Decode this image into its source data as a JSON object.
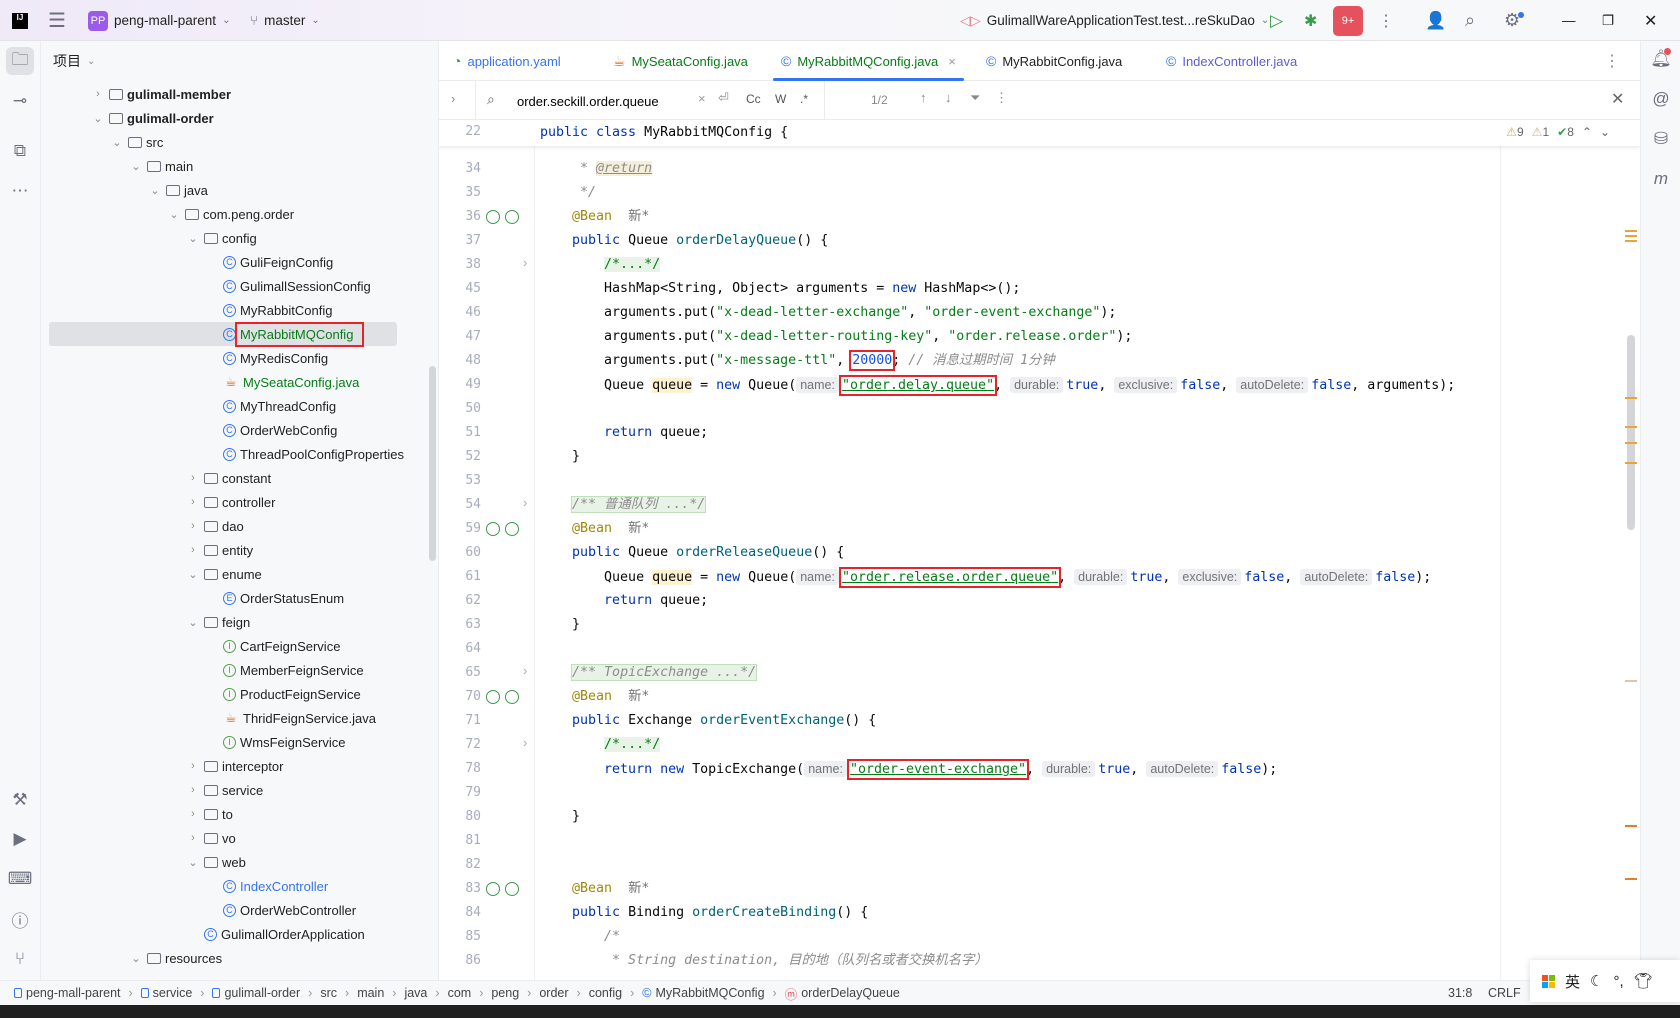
{
  "titlebar": {
    "app_logo": "IJ",
    "project_badge": "PP",
    "project_name": "peng-mall-parent",
    "branch": "master",
    "run_config": "GulimallWareApplicationTest.test...reSkuDao",
    "notif_badge": "9+",
    "icons": [
      "main-menu-icon",
      "branch-icon",
      "run-icon",
      "debug-icon",
      "more-icon",
      "add-user-icon",
      "search-icon",
      "settings-icon",
      "minimize-icon",
      "restore-icon",
      "close-icon"
    ]
  },
  "project_panel": {
    "title": "项目",
    "selected": "MyRabbitMQConfig",
    "items": [
      {
        "label": "gulimall-member",
        "level": 0,
        "arrow": "closed",
        "icon": "module",
        "bold": true
      },
      {
        "label": "gulimall-order",
        "level": 0,
        "arrow": "open",
        "icon": "module",
        "bold": true
      },
      {
        "label": "src",
        "level": 1,
        "arrow": "open",
        "icon": "folder"
      },
      {
        "label": "main",
        "level": 2,
        "arrow": "open",
        "icon": "folder"
      },
      {
        "label": "java",
        "level": 3,
        "arrow": "open",
        "icon": "src-folder"
      },
      {
        "label": "com.peng.order",
        "level": 4,
        "arrow": "open",
        "icon": "package"
      },
      {
        "label": "config",
        "level": 5,
        "arrow": "open",
        "icon": "package"
      },
      {
        "label": "GuliFeignConfig",
        "level": 6,
        "icon": "class"
      },
      {
        "label": "GulimallSessionConfig",
        "level": 6,
        "icon": "class"
      },
      {
        "label": "MyRabbitConfig",
        "level": 6,
        "icon": "class"
      },
      {
        "label": "MyRabbitMQConfig",
        "level": 6,
        "icon": "class",
        "color": "#067d17",
        "selected": true
      },
      {
        "label": "MyRedisConfig",
        "level": 6,
        "icon": "class"
      },
      {
        "label": "MySeataConfig.java",
        "level": 6,
        "icon": "java",
        "color": "#067d17"
      },
      {
        "label": "MyThreadConfig",
        "level": 6,
        "icon": "class"
      },
      {
        "label": "OrderWebConfig",
        "level": 6,
        "icon": "class"
      },
      {
        "label": "ThreadPoolConfigProperties",
        "level": 6,
        "icon": "class"
      },
      {
        "label": "constant",
        "level": 5,
        "arrow": "closed",
        "icon": "package"
      },
      {
        "label": "controller",
        "level": 5,
        "arrow": "closed",
        "icon": "package"
      },
      {
        "label": "dao",
        "level": 5,
        "arrow": "closed",
        "icon": "package"
      },
      {
        "label": "entity",
        "level": 5,
        "arrow": "closed",
        "icon": "package"
      },
      {
        "label": "enume",
        "level": 5,
        "arrow": "open",
        "icon": "package"
      },
      {
        "label": "OrderStatusEnum",
        "level": 6,
        "icon": "enum"
      },
      {
        "label": "feign",
        "level": 5,
        "arrow": "open",
        "icon": "package"
      },
      {
        "label": "CartFeignService",
        "level": 6,
        "icon": "interface"
      },
      {
        "label": "MemberFeignService",
        "level": 6,
        "icon": "interface"
      },
      {
        "label": "ProductFeignService",
        "level": 6,
        "icon": "interface"
      },
      {
        "label": "ThridFeignService.java",
        "level": 6,
        "icon": "java"
      },
      {
        "label": "WmsFeignService",
        "level": 6,
        "icon": "interface"
      },
      {
        "label": "interceptor",
        "level": 5,
        "arrow": "closed",
        "icon": "package"
      },
      {
        "label": "service",
        "level": 5,
        "arrow": "closed",
        "icon": "package"
      },
      {
        "label": "to",
        "level": 5,
        "arrow": "closed",
        "icon": "package"
      },
      {
        "label": "vo",
        "level": 5,
        "arrow": "closed",
        "icon": "package"
      },
      {
        "label": "web",
        "level": 5,
        "arrow": "open",
        "icon": "package"
      },
      {
        "label": "IndexController",
        "level": 6,
        "icon": "class",
        "color": "#3574f0"
      },
      {
        "label": "OrderWebController",
        "level": 6,
        "icon": "class"
      },
      {
        "label": "GulimallOrderApplication",
        "level": 5,
        "icon": "spring-app"
      },
      {
        "label": "resources",
        "level": 2,
        "arrow": "open",
        "icon": "resources-folder"
      }
    ]
  },
  "tabs": [
    {
      "label": "application.yaml",
      "icon": "yaml-icon",
      "color": "#3574f0"
    },
    {
      "label": "MySeataConfig.java",
      "icon": "java-icon",
      "color": "#067d17"
    },
    {
      "label": "MyRabbitMQConfig.java",
      "icon": "class-icon",
      "color": "#067d17",
      "active": true,
      "closable": true
    },
    {
      "label": "MyRabbitConfig.java",
      "icon": "class-icon",
      "color": "#222222"
    },
    {
      "label": "IndexController.java",
      "icon": "class-icon",
      "color": "#5c5cd6"
    }
  ],
  "find": {
    "query": "order.seckill.order.queue",
    "options": [
      "Cc",
      "W",
      ".*"
    ],
    "match_count": "1/2"
  },
  "inspections": {
    "warnings": "9",
    "weak_warnings": "1",
    "ok": "8"
  },
  "sticky": {
    "num": "22",
    "tokens": [
      [
        "public class ",
        "kw"
      ],
      [
        "MyRabbitMQConfig {",
        "plain"
      ]
    ]
  },
  "code": [
    {
      "num": "34",
      "tokens": [
        [
          "     * ",
          "cm"
        ],
        [
          "@return",
          "doctag"
        ]
      ]
    },
    {
      "num": "35",
      "tokens": [
        [
          "     */",
          "cm"
        ]
      ]
    },
    {
      "num": "36",
      "gutter": true,
      "tokens": [
        [
          "    ",
          "plain"
        ],
        [
          "@Bean",
          "ann"
        ],
        [
          "  新*",
          "ai"
        ]
      ]
    },
    {
      "num": "37",
      "tokens": [
        [
          "    public ",
          "kw"
        ],
        [
          "Queue ",
          "plain"
        ],
        [
          "orderDelayQueue",
          "fn"
        ],
        [
          "() {",
          "plain"
        ]
      ]
    },
    {
      "num": "38",
      "fold": true,
      "tokens": [
        [
          "        ",
          "plain"
        ],
        [
          "/*...*/",
          "fold"
        ]
      ]
    },
    {
      "num": "45",
      "tokens": [
        [
          "        HashMap<String, Object> arguments = ",
          "plain"
        ],
        [
          "new ",
          "kw"
        ],
        [
          "HashMap<>();",
          "plain"
        ]
      ]
    },
    {
      "num": "46",
      "tokens": [
        [
          "        arguments.put(",
          "plain"
        ],
        [
          "\"x-dead-letter-exchange\"",
          "str"
        ],
        [
          ", ",
          "plain"
        ],
        [
          "\"order-event-exchange\"",
          "str"
        ],
        [
          ");",
          "plain"
        ]
      ]
    },
    {
      "num": "47",
      "tokens": [
        [
          "        arguments.put(",
          "plain"
        ],
        [
          "\"x-dead-letter-routing-key\"",
          "str"
        ],
        [
          ", ",
          "plain"
        ],
        [
          "\"order.release.order\"",
          "str"
        ],
        [
          ");",
          "plain"
        ]
      ]
    },
    {
      "num": "48",
      "tokens": [
        [
          "        arguments.put(",
          "plain"
        ],
        [
          "\"x-message-ttl\"",
          "str"
        ],
        [
          ", ",
          "plain"
        ],
        [
          "20000",
          "num box"
        ],
        [
          "; ",
          "plain"
        ],
        [
          "// 消息过期时间 1分钟",
          "cm"
        ]
      ]
    },
    {
      "num": "49",
      "tokens": [
        [
          "        Queue ",
          "plain"
        ],
        [
          "queue",
          "plain ref"
        ],
        [
          " = ",
          "plain"
        ],
        [
          "new ",
          "kw"
        ],
        [
          "Queue(",
          "plain"
        ],
        [
          "name:",
          "hint"
        ],
        [
          "\"order.delay.queue\"",
          "strU box"
        ],
        [
          ", ",
          "plain"
        ],
        [
          "durable:",
          "hint"
        ],
        [
          "true",
          "kw"
        ],
        [
          ", ",
          "plain"
        ],
        [
          "exclusive:",
          "hint"
        ],
        [
          "false",
          "kw"
        ],
        [
          ", ",
          "plain"
        ],
        [
          "autoDelete:",
          "hint"
        ],
        [
          "false",
          "kw"
        ],
        [
          ", arguments);",
          "plain"
        ]
      ]
    },
    {
      "num": "50",
      "tokens": []
    },
    {
      "num": "51",
      "tokens": [
        [
          "        return ",
          "kw"
        ],
        [
          "queue;",
          "plain"
        ]
      ]
    },
    {
      "num": "52",
      "tokens": [
        [
          "    }",
          "plain"
        ]
      ]
    },
    {
      "num": "53",
      "tokens": []
    },
    {
      "num": "54",
      "fold": true,
      "tokens": [
        [
          "    ",
          "plain"
        ],
        [
          "/** 普通队列 ...*/",
          "fold2"
        ]
      ]
    },
    {
      "num": "59",
      "gutter": true,
      "tokens": [
        [
          "    ",
          "plain"
        ],
        [
          "@Bean",
          "ann"
        ],
        [
          "  新*",
          "ai"
        ]
      ]
    },
    {
      "num": "60",
      "tokens": [
        [
          "    public ",
          "kw"
        ],
        [
          "Queue ",
          "plain"
        ],
        [
          "orderReleaseQueue",
          "fn"
        ],
        [
          "() {",
          "plain"
        ]
      ]
    },
    {
      "num": "61",
      "tokens": [
        [
          "        Queue ",
          "plain"
        ],
        [
          "queue",
          "plain ref"
        ],
        [
          " = ",
          "plain"
        ],
        [
          "new ",
          "kw"
        ],
        [
          "Queue(",
          "plain"
        ],
        [
          "name:",
          "hint"
        ],
        [
          "\"order.release.order.queue\"",
          "strU box"
        ],
        [
          ", ",
          "plain"
        ],
        [
          "durable:",
          "hint"
        ],
        [
          "true",
          "kw"
        ],
        [
          ", ",
          "plain"
        ],
        [
          "exclusive:",
          "hint"
        ],
        [
          "false",
          "kw"
        ],
        [
          ", ",
          "plain"
        ],
        [
          "autoDelete:",
          "hint"
        ],
        [
          "false",
          "kw"
        ],
        [
          ");",
          "plain"
        ]
      ]
    },
    {
      "num": "62",
      "tokens": [
        [
          "        return ",
          "kw"
        ],
        [
          "queue;",
          "plain"
        ]
      ]
    },
    {
      "num": "63",
      "tokens": [
        [
          "    }",
          "plain"
        ]
      ]
    },
    {
      "num": "64",
      "tokens": []
    },
    {
      "num": "65",
      "fold": true,
      "tokens": [
        [
          "    ",
          "plain"
        ],
        [
          "/** TopicExchange ...*/",
          "fold2"
        ]
      ]
    },
    {
      "num": "70",
      "gutter": true,
      "tokens": [
        [
          "    ",
          "plain"
        ],
        [
          "@Bean",
          "ann"
        ],
        [
          "  新*",
          "ai"
        ]
      ]
    },
    {
      "num": "71",
      "tokens": [
        [
          "    public ",
          "kw"
        ],
        [
          "Exchange ",
          "plain"
        ],
        [
          "orderEventExchange",
          "fn"
        ],
        [
          "() {",
          "plain"
        ]
      ]
    },
    {
      "num": "72",
      "fold": true,
      "tokens": [
        [
          "        ",
          "plain"
        ],
        [
          "/*...*/",
          "fold"
        ]
      ]
    },
    {
      "num": "78",
      "tokens": [
        [
          "        return new ",
          "kw"
        ],
        [
          "TopicExchange(",
          "plain"
        ],
        [
          "name:",
          "hint"
        ],
        [
          "\"order-event-exchange\"",
          "strU box"
        ],
        [
          ", ",
          "plain"
        ],
        [
          "durable:",
          "hint"
        ],
        [
          "true",
          "kw"
        ],
        [
          ", ",
          "plain"
        ],
        [
          "autoDelete:",
          "hint"
        ],
        [
          "false",
          "kw"
        ],
        [
          ");",
          "plain"
        ]
      ]
    },
    {
      "num": "79",
      "tokens": []
    },
    {
      "num": "80",
      "tokens": [
        [
          "    }",
          "plain"
        ]
      ]
    },
    {
      "num": "81",
      "tokens": []
    },
    {
      "num": "82",
      "tokens": []
    },
    {
      "num": "83",
      "gutter": true,
      "tokens": [
        [
          "    ",
          "plain"
        ],
        [
          "@Bean",
          "ann"
        ],
        [
          "  新*",
          "ai"
        ]
      ]
    },
    {
      "num": "84",
      "tokens": [
        [
          "    public ",
          "kw"
        ],
        [
          "Binding ",
          "plain"
        ],
        [
          "orderCreateBinding",
          "fn"
        ],
        [
          "() {",
          "plain"
        ]
      ]
    },
    {
      "num": "85",
      "tokens": [
        [
          "        /*",
          "cm"
        ]
      ]
    },
    {
      "num": "86",
      "tokens": [
        [
          "         * String destination, 目的地（队列名或者交换机名字）",
          "cm"
        ]
      ]
    }
  ],
  "breadcrumb": [
    "peng-mall-parent",
    "service",
    "gulimall-order",
    "src",
    "main",
    "java",
    "com",
    "peng",
    "order",
    "config",
    "MyRabbitMQConfig",
    "orderDelayQueue"
  ],
  "status": {
    "position": "31:8",
    "line_sep": "CRLF"
  },
  "ime": {
    "mode": "英"
  },
  "colors": {
    "accent": "#3574f0",
    "highlight_box": "#e8242b",
    "selected_row": "#dfe1e5"
  }
}
